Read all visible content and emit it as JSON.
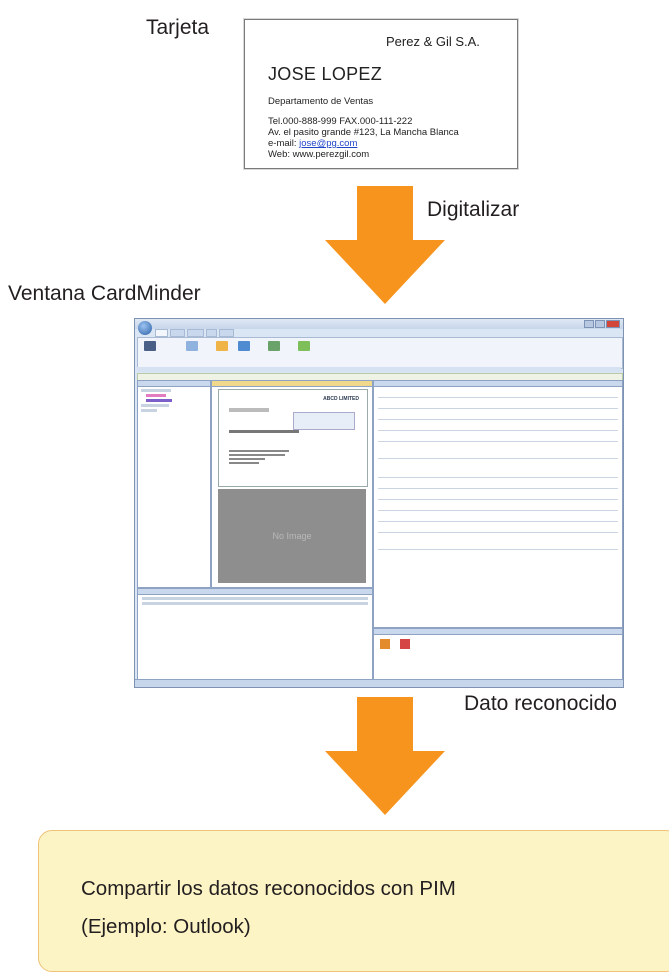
{
  "labels": {
    "card": "Tarjeta",
    "scan": "Digitalizar",
    "window": "Ventana CardMinder",
    "recognized": "Dato reconocido"
  },
  "business_card": {
    "company": "Perez & Gil S.A.",
    "name": "JOSE LOPEZ",
    "department": "Departamento de Ventas",
    "phone_line": "Tel.000-888-999   FAX.000-111-222",
    "address": "Av. el pasito grande #123, La Mancha Blanca",
    "email_label": "e-mail: ",
    "email": "jose@pg.com",
    "web": "Web: www.perezgil.com"
  },
  "screenshot": {
    "card_company": "ABCD LIMITED",
    "no_image": "No Image"
  },
  "share": {
    "line1": "Compartir los datos reconocidos con PIM",
    "line2": "(Ejemplo: Outlook)"
  },
  "colors": {
    "arrow": "#f7941d",
    "box_fill": "#fdf4c6",
    "box_border": "#f0c277"
  }
}
